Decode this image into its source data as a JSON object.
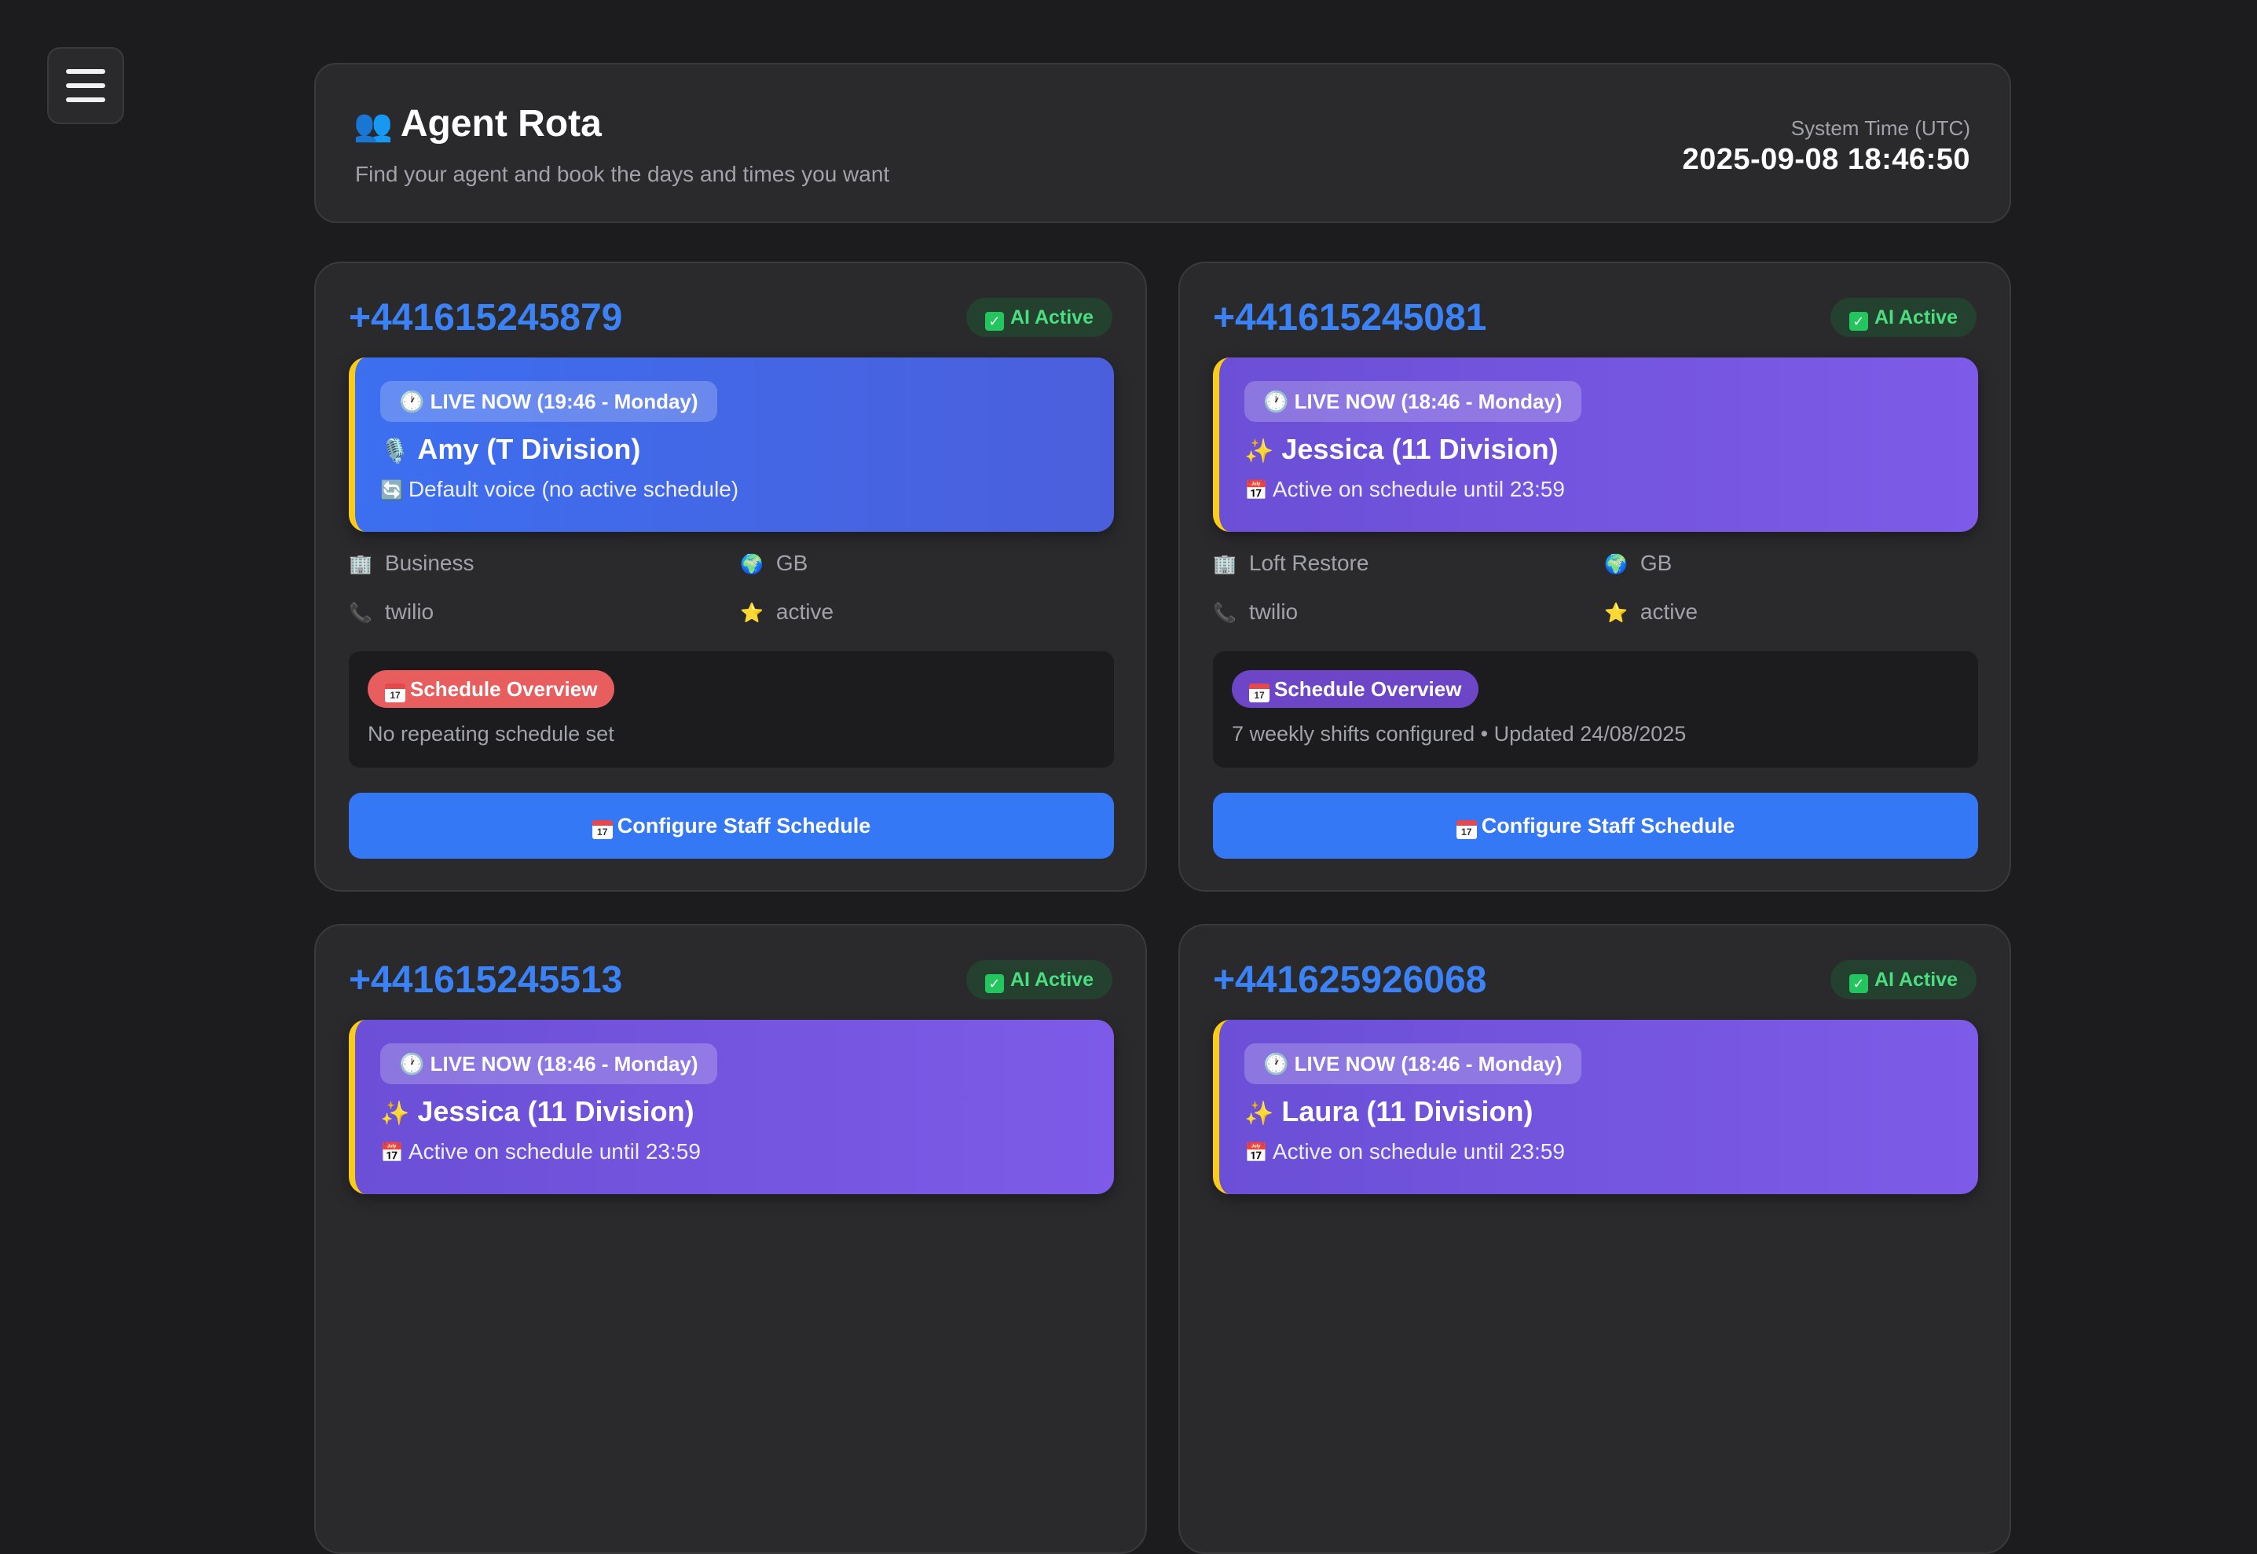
{
  "header": {
    "title_emoji": "👥",
    "title": "Agent Rota",
    "subtitle": "Find your agent and book the days and times you want",
    "time_label": "System Time (UTC)",
    "time_value": "2025-09-08 18:46:50"
  },
  "cards": [
    {
      "phone": "+441615245879",
      "status": "AI Active",
      "live_badge": "LIVE NOW (19:46 - Monday)",
      "agent_emoji": "🎙️",
      "agent": "Amy (T Division)",
      "note_emoji": "🔄",
      "note": "Default voice (no active schedule)",
      "company": "Business",
      "region": "GB",
      "provider": "twilio",
      "state": "active",
      "schedule_label": "Schedule Overview",
      "schedule_text": "No repeating schedule set",
      "configure_label": "Configure Staff Schedule",
      "accent": "#e85d5d"
    },
    {
      "phone": "+441615245081",
      "status": "AI Active",
      "live_badge": "LIVE NOW (18:46 - Monday)",
      "agent_emoji": "✨",
      "agent": "Jessica (11 Division)",
      "note_emoji": "📅",
      "note": "Active on schedule until 23:59",
      "company": "Loft Restore",
      "region": "GB",
      "provider": "twilio",
      "state": "active",
      "schedule_label": "Schedule Overview",
      "schedule_text": "7 weekly shifts configured • Updated 24/08/2025",
      "configure_label": "Configure Staff Schedule",
      "accent": "#6d46c8"
    },
    {
      "phone": "+441615245513",
      "status": "AI Active",
      "live_badge": "LIVE NOW (18:46 - Monday)",
      "agent_emoji": "✨",
      "agent": "Jessica (11 Division)",
      "note_emoji": "📅",
      "note": "Active on schedule until 23:59"
    },
    {
      "phone": "+441625926068",
      "status": "AI Active",
      "live_badge": "LIVE NOW (18:46 - Monday)",
      "agent_emoji": "✨",
      "agent": "Laura (11 Division)",
      "note_emoji": "📅",
      "note": "Active on schedule until 23:59"
    }
  ],
  "icons": {
    "menu": "hamburger-menu-icon",
    "company": "building-icon",
    "region": "globe-icon",
    "provider": "phone-icon",
    "state": "star-icon",
    "live": "clock-icon",
    "schedule": "calendar-icon"
  },
  "colors": {
    "background": "#1c1c1e",
    "card": "#2a2a2d",
    "phone": "#3a82f6",
    "active_badge": "#4ade80",
    "live_blue": "#3b6ff0",
    "live_purple": "#7d5be8",
    "live_border": "#facc15",
    "button": "#3478f6"
  }
}
